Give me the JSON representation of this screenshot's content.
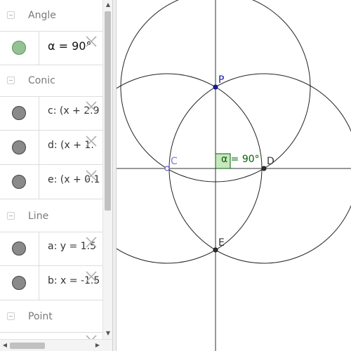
{
  "algebra": {
    "groups": [
      {
        "title": "Angle",
        "items": [
          {
            "formula": "α = 90°",
            "color": "green"
          }
        ]
      },
      {
        "title": "Conic",
        "items": [
          {
            "formula": "c: (x + 2.9",
            "color": "gray"
          },
          {
            "formula": "d: (x + 1.",
            "color": "gray"
          },
          {
            "formula": "e: (x + 0.1",
            "color": "gray"
          }
        ]
      },
      {
        "title": "Line",
        "items": [
          {
            "formula": "a: y = 1.5",
            "color": "gray"
          },
          {
            "formula": "b: x = -1.5",
            "color": "gray"
          }
        ]
      },
      {
        "title": "Point",
        "items": []
      }
    ]
  },
  "graphics": {
    "points": [
      {
        "name": "P",
        "color": "#1a1aa6"
      },
      {
        "name": "C",
        "color": "#7a7ae0"
      },
      {
        "name": "D",
        "color": "#333333"
      },
      {
        "name": "E",
        "color": "#333333"
      }
    ],
    "angle_label": "α = 90°",
    "angle_color": "#006400",
    "angle_fill": "#c8e6c0"
  },
  "icons": {
    "scroll_up": "▲",
    "scroll_down": "▼",
    "scroll_left": "◀",
    "scroll_right": "▶"
  }
}
